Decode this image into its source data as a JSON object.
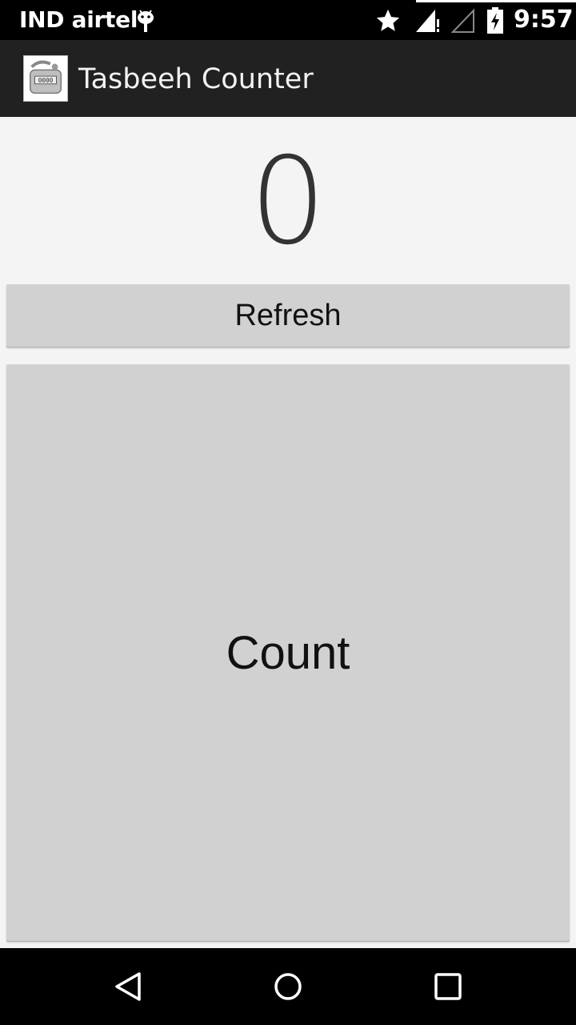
{
  "status_bar": {
    "carrier": "IND airtel",
    "time": "9:57",
    "icons": [
      "android-debug-icon",
      "star-icon",
      "signal-icon",
      "no-signal-icon",
      "battery-charging-icon"
    ]
  },
  "action_bar": {
    "title": "Tasbeeh Counter",
    "logo_icon": "tally-counter-icon",
    "background": "#212121"
  },
  "counter": {
    "value": "0"
  },
  "buttons": {
    "refresh_label": "Refresh",
    "count_label": "Count",
    "background": "#d1d1d1"
  },
  "nav_bar": {
    "icons": [
      "back-icon",
      "home-icon",
      "recents-icon"
    ]
  }
}
